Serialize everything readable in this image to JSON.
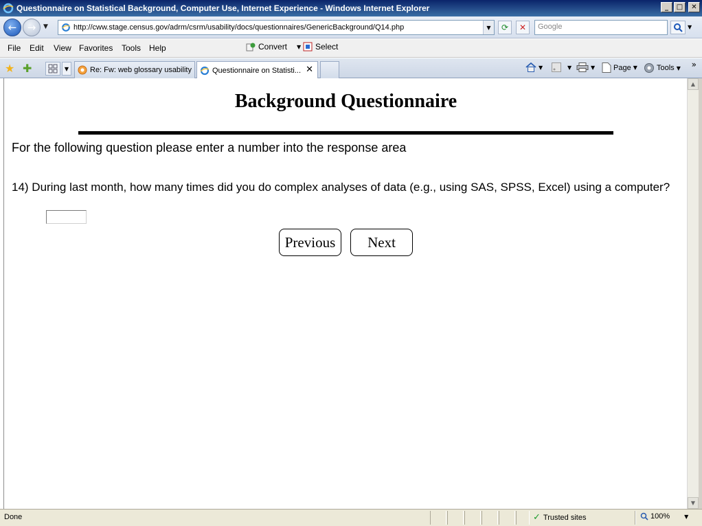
{
  "window": {
    "title": "Questionnaire on Statistical Background, Computer Use, Internet Experience - Windows Internet Explorer",
    "minimize_glyph": "_",
    "maximize_glyph": "□",
    "close_glyph": "✕"
  },
  "address": {
    "url": "http://cww.stage.census.gov/adrm/csrm/usability/docs/questionnaires/GenericBackground/Q14.php",
    "search_placeholder": "Google"
  },
  "menu": {
    "items": [
      "File",
      "Edit",
      "View",
      "Favorites",
      "Tools",
      "Help"
    ],
    "convert_label": "Convert",
    "select_label": "Select"
  },
  "tabs": [
    {
      "label": "Re: Fw: web glossary usability",
      "active": false
    },
    {
      "label": "Questionnaire on Statisti...",
      "active": true
    }
  ],
  "command_bar": {
    "page_label": "Page",
    "tools_label": "Tools"
  },
  "page": {
    "heading": "Background Questionnaire",
    "instruction": "For the following question please enter a number into the response area",
    "question": "14) During last month, how many times did you do complex analyses of data (e.g., using SAS, SPSS, Excel) using a computer?",
    "answer_value": "",
    "previous_label": "Previous",
    "next_label": "Next"
  },
  "status": {
    "text": "Done",
    "zone": "Trusted sites",
    "zoom": "100%"
  },
  "colors": {
    "titlebar": "#0a246a",
    "accent": "#1a56b8",
    "trusted_check": "#1a9b2a"
  },
  "icons": [
    "ie-logo-icon",
    "back-arrow-icon",
    "forward-arrow-icon",
    "refresh-icon",
    "stop-icon",
    "search-icon",
    "favorites-star-icon",
    "add-favorites-icon",
    "quick-tabs-icon",
    "home-icon",
    "feeds-icon",
    "print-icon",
    "page-icon",
    "tools-gear-icon",
    "checkmark-icon",
    "zoom-icon"
  ]
}
